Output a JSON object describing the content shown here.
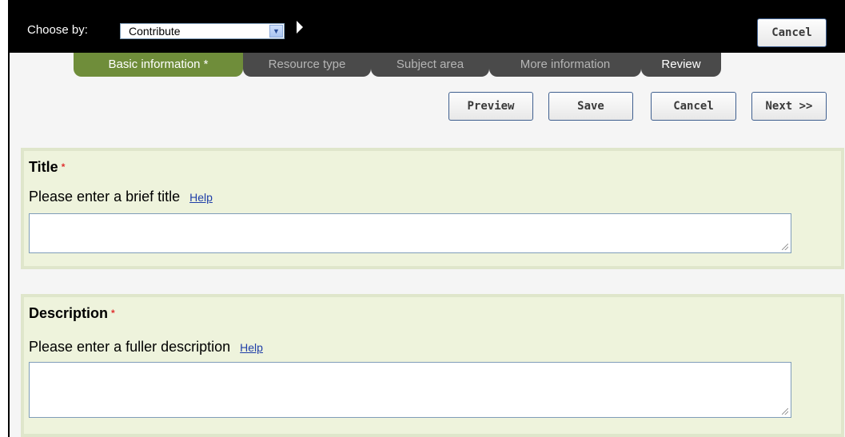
{
  "topbar": {
    "choose_label": "Choose by:",
    "select_value": "Contribute",
    "cancel_label": "Cancel"
  },
  "tabs": [
    {
      "label": "Basic information *",
      "state": "active"
    },
    {
      "label": "Resource type",
      "state": "inactive"
    },
    {
      "label": "Subject area",
      "state": "inactive"
    },
    {
      "label": "More information",
      "state": "inactive"
    },
    {
      "label": "Review",
      "state": "inactive"
    }
  ],
  "actions": {
    "preview": "Preview",
    "save": "Save",
    "cancel": "Cancel",
    "next": "Next >>"
  },
  "title_section": {
    "heading": "Title",
    "required_mark": "*",
    "prompt": "Please enter a brief title",
    "help": "Help",
    "value": ""
  },
  "description_section": {
    "heading": "Description",
    "required_mark": "*",
    "prompt": "Please enter a fuller description",
    "help": "Help",
    "value": ""
  },
  "colors": {
    "active_tab": "#6f8d3a",
    "inactive_tab": "#4a4a4a",
    "panel_bg": "#eef3dc",
    "required": "#e03030",
    "link": "#1f3ea8"
  }
}
